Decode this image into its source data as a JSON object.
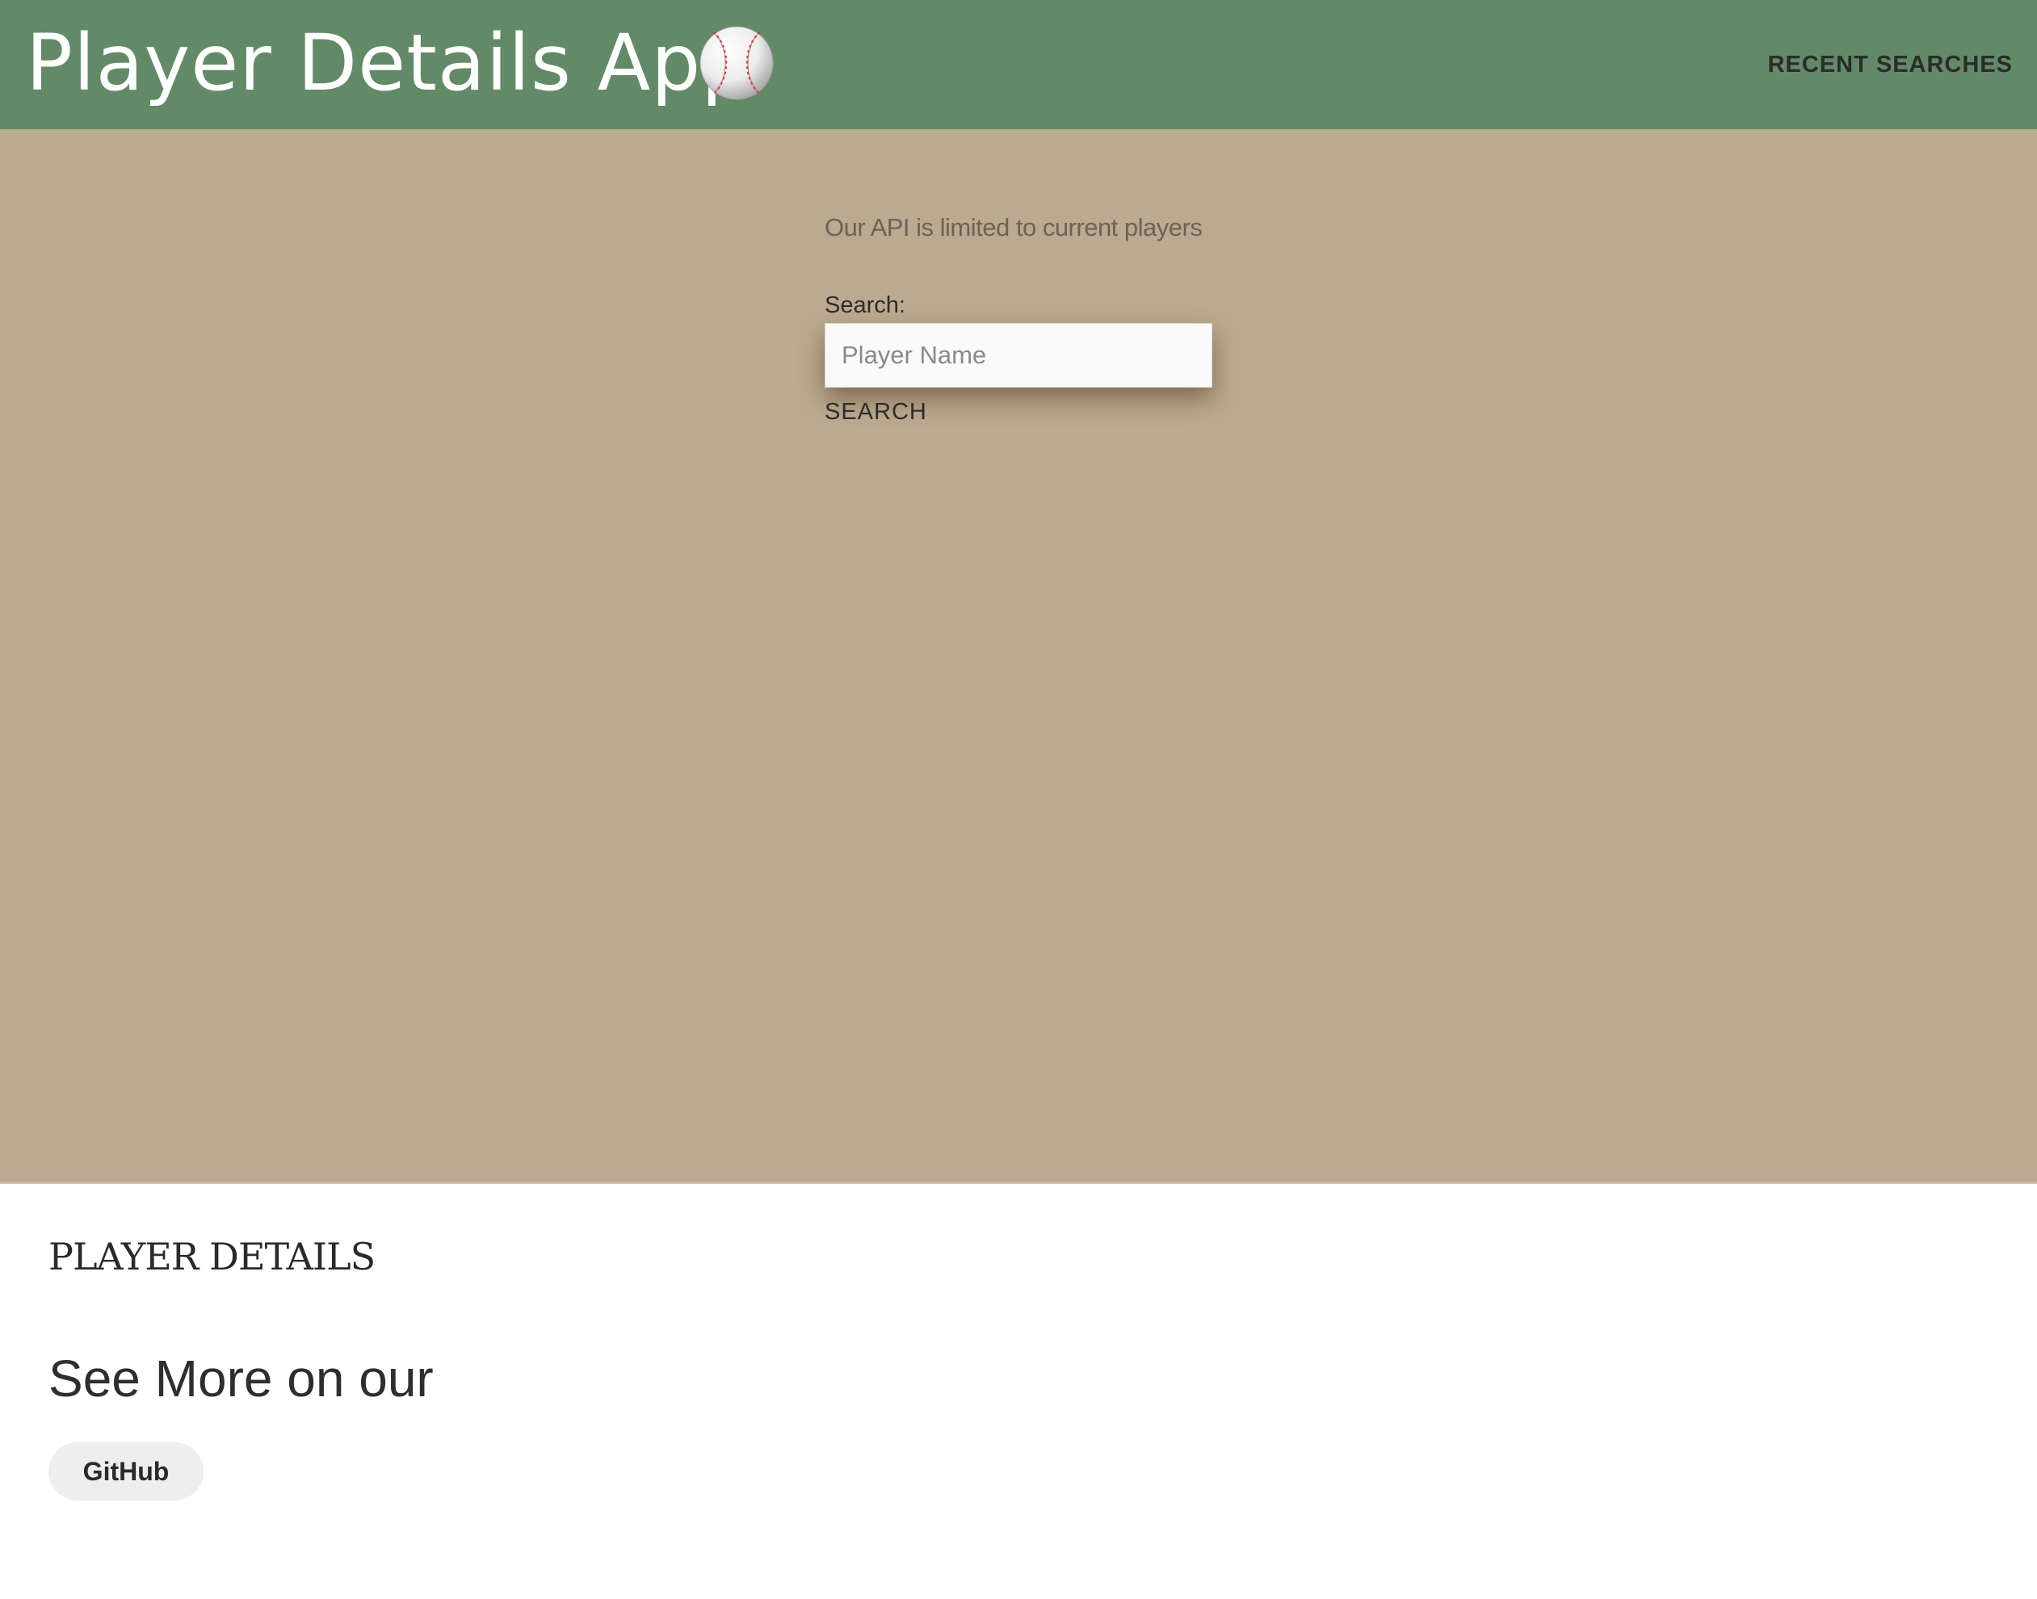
{
  "header": {
    "title": "Player Details App",
    "icon": "baseball-icon",
    "background_color": "#638a66",
    "nav_link": "RECENT SEARCHES"
  },
  "hero": {
    "background_color": "#bbaa8f",
    "api_note": "Our API is limited to current players",
    "search_label": "Search:",
    "search_placeholder": "Player Name",
    "search_value": "",
    "search_button": "SEARCH"
  },
  "details": {
    "heading": "PLAYER DETAILS",
    "see_more": "See More on our",
    "github_button": "GitHub"
  }
}
